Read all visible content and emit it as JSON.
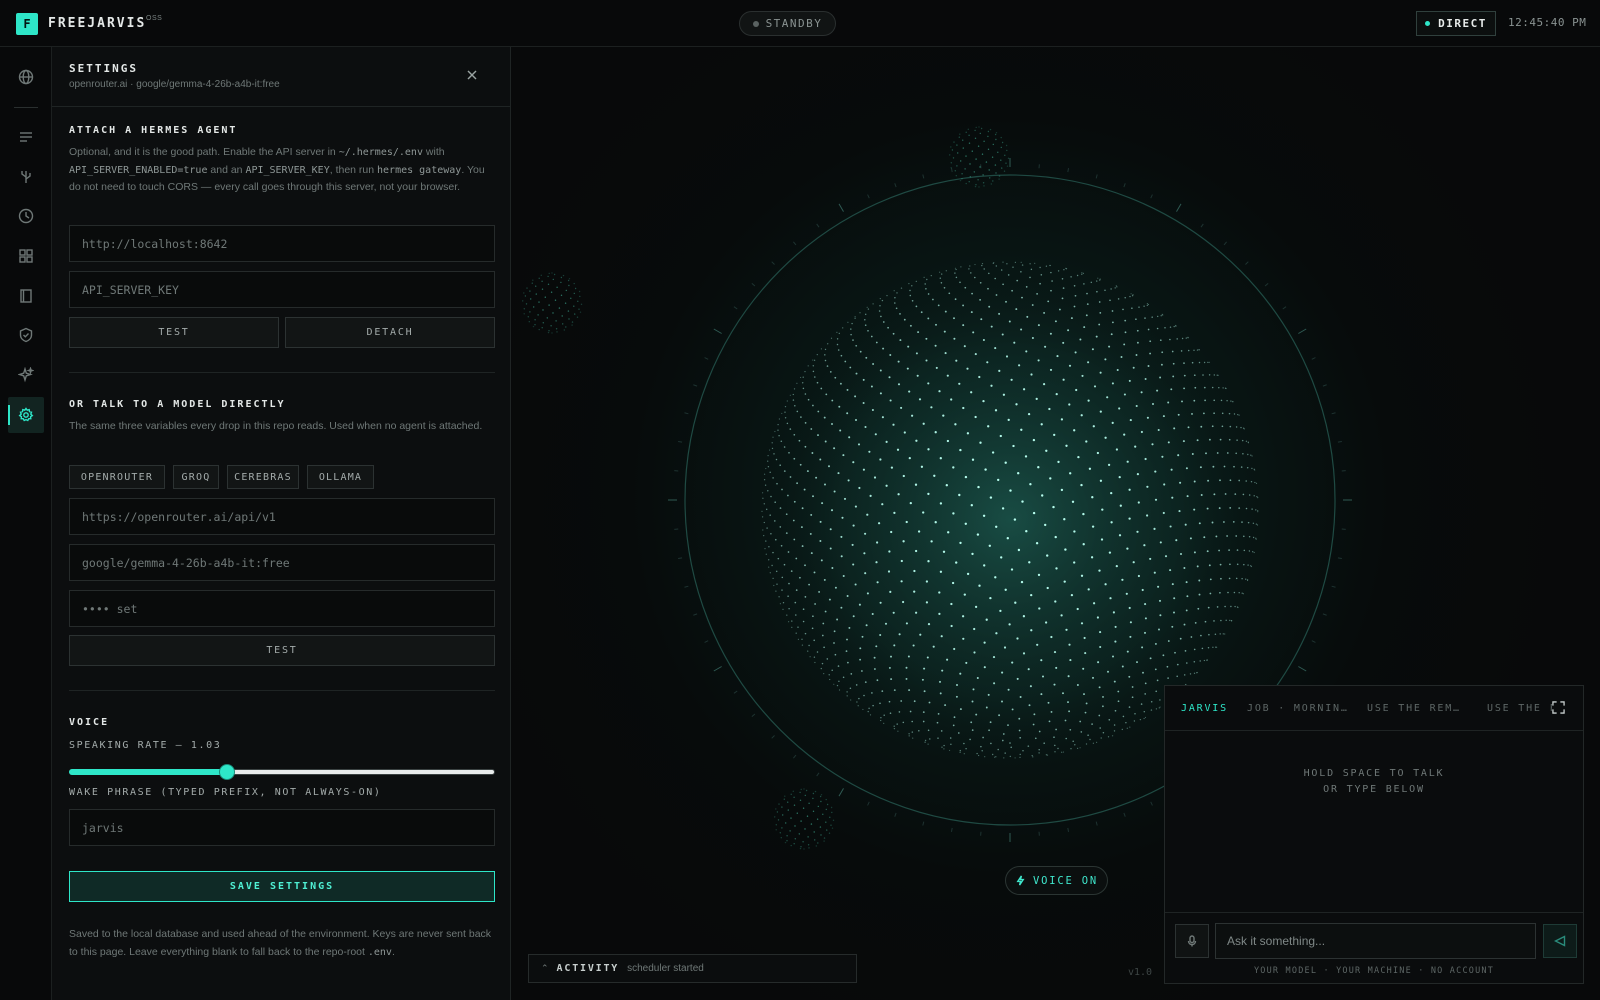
{
  "topbar": {
    "logo_letter": "F",
    "app_name": "FREEJARVIS",
    "app_badge": "OSS",
    "status": "STANDBY",
    "mode": "DIRECT",
    "time": "12:45:40 PM"
  },
  "rail": {
    "icons": [
      "globe-icon",
      "list-icon",
      "branch-icon",
      "clock-icon",
      "grid-icon",
      "book-icon",
      "shield-icon",
      "sparkle-icon",
      "gear-icon"
    ],
    "active": "gear-icon"
  },
  "settings": {
    "title": "SETTINGS",
    "subtitle": "openrouter.ai · google/gemma-4-26b-a4b-it:free",
    "hermes": {
      "title": "ATTACH A HERMES AGENT",
      "desc_1": "Optional, and it is the good path. Enable the API server in ",
      "desc_code_1": "~/.hermes/.env",
      "desc_2": " with ",
      "desc_code_2": "API_SERVER_ENABLED=true",
      "desc_3": " and an ",
      "desc_code_3": "API_SERVER_KEY",
      "desc_4": ", then run ",
      "desc_code_4": "hermes gateway",
      "desc_5": ". You do not need to touch CORS — every call goes through this server, not your browser.",
      "url_placeholder": "http://localhost:8642",
      "key_placeholder": "API_SERVER_KEY",
      "test_label": "TEST",
      "detach_label": "DETACH"
    },
    "direct": {
      "title": "OR TALK TO A MODEL DIRECTLY",
      "desc": "The same three variables every drop in this repo reads. Used when no agent is attached.",
      "providers": [
        "OPENROUTER",
        "GROQ",
        "CEREBRAS",
        "OLLAMA"
      ],
      "base_url": "https://openrouter.ai/api/v1",
      "model": "google/gemma-4-26b-a4b-it:free",
      "key_placeholder": "•••• set",
      "test_label": "TEST"
    },
    "voice": {
      "title": "VOICE",
      "rate_label": "SPEAKING RATE — 1.03",
      "rate_fraction": 0.37,
      "wake_label": "WAKE PHRASE (TYPED PREFIX, NOT ALWAYS-ON)",
      "wake_placeholder": "jarvis"
    },
    "save_label": "SAVE SETTINGS",
    "footer_1": "Saved to the local database and used ahead of the environment. Keys are never sent back to this page. Leave everything blank to fall back to the repo-root ",
    "footer_code": ".env",
    "footer_2": "."
  },
  "stage": {
    "voice_label": "VOICE ON",
    "activity_label": "ACTIVITY",
    "activity_msg": "scheduler started",
    "version": "v1.0"
  },
  "chat": {
    "tabs": [
      "JARVIS",
      "JOB · MORNIN…",
      "USE THE REM…",
      "USE THE F"
    ],
    "hint_line1": "HOLD SPACE TO TALK",
    "hint_line2": "OR TYPE BELOW",
    "input_placeholder": "Ask it something...",
    "footer": "YOUR MODEL · YOUR MACHINE · NO ACCOUNT"
  },
  "colors": {
    "accent": "#2ee6c8",
    "background": "#08090a",
    "panel": "#0c0e0f"
  }
}
